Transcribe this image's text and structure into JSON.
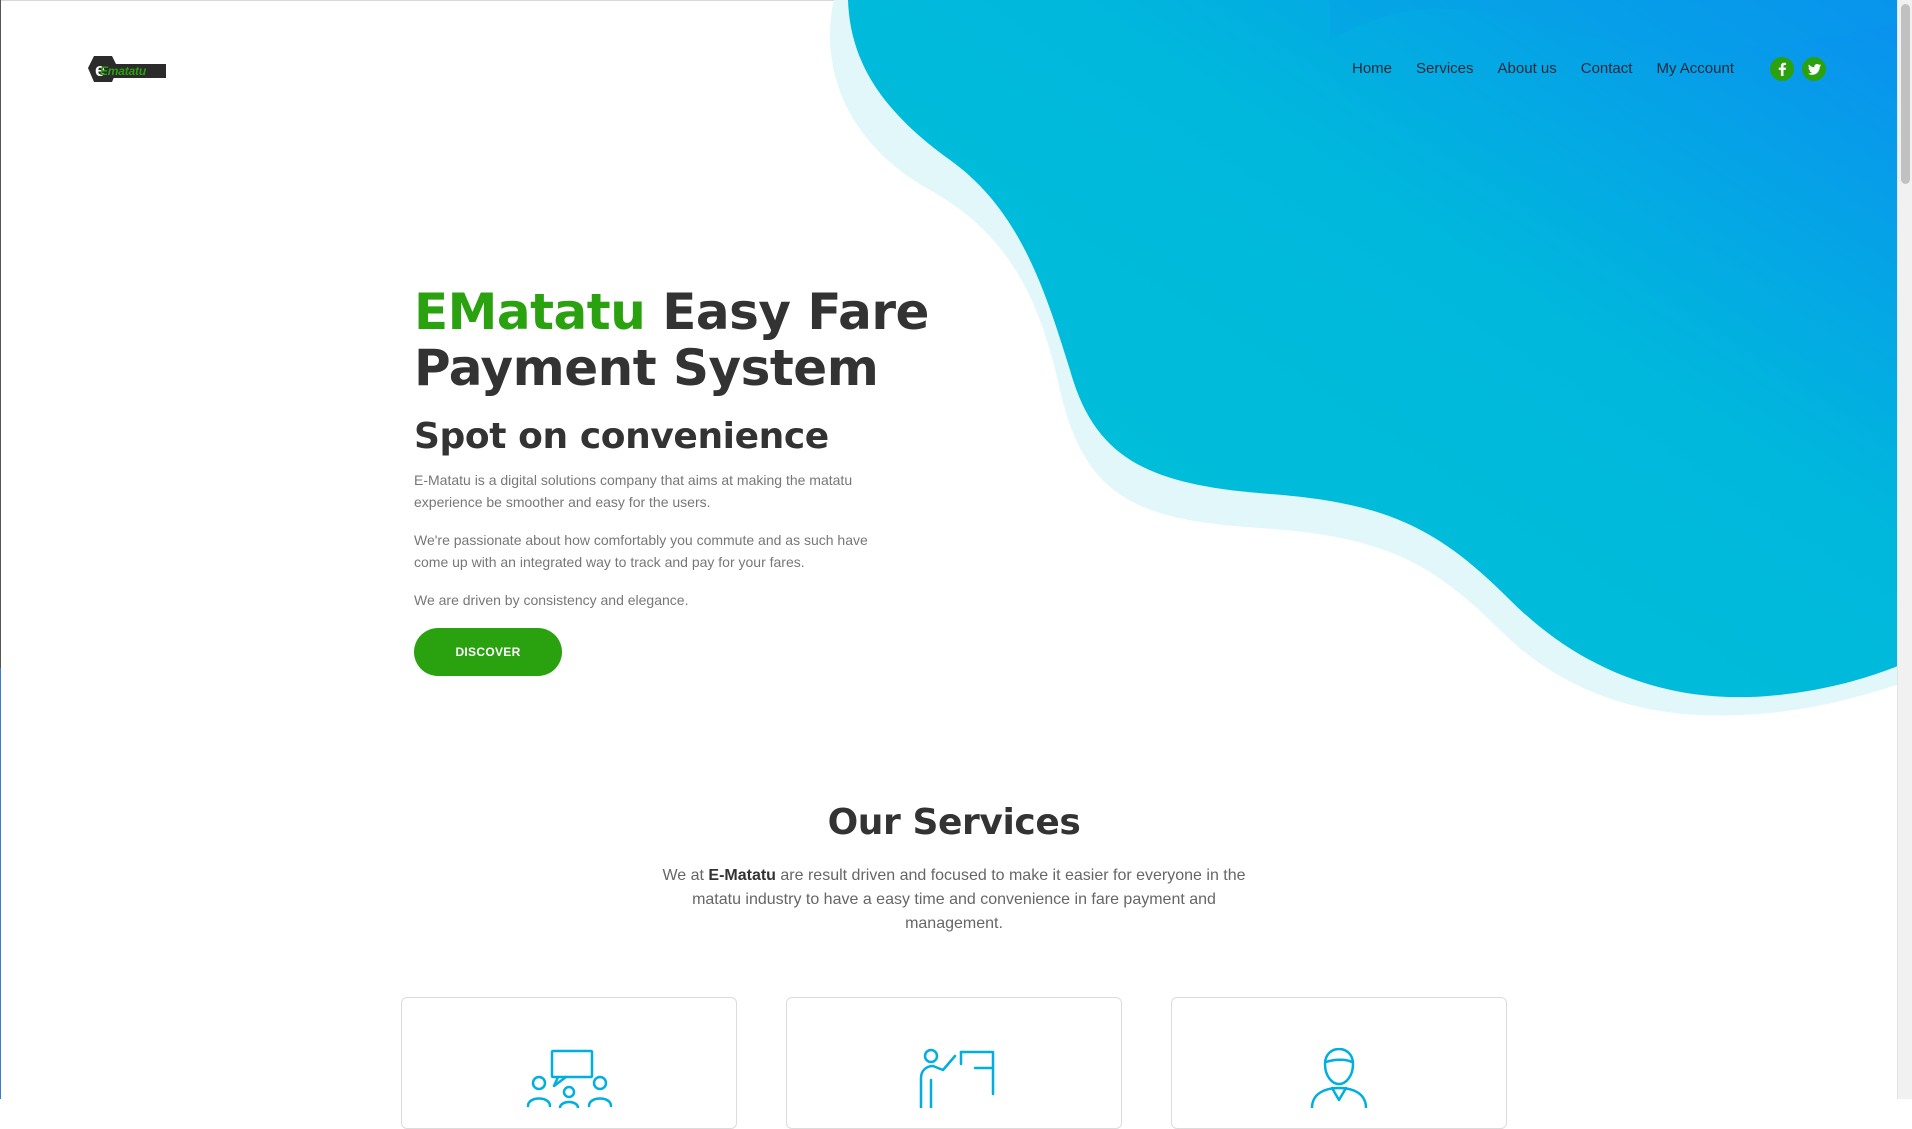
{
  "brand": {
    "logo_text": "Ematatu",
    "accent_color": "#2aa10f",
    "wave_color": "#00bcd4"
  },
  "nav": {
    "items": [
      {
        "label": "Home"
      },
      {
        "label": "Services"
      },
      {
        "label": "About us"
      },
      {
        "label": "Contact"
      },
      {
        "label": "My Account"
      }
    ],
    "socials": [
      {
        "icon": "facebook-icon",
        "glyph": "f"
      },
      {
        "icon": "twitter-icon",
        "glyph": "t"
      }
    ]
  },
  "hero": {
    "title_accent": "EMatatu",
    "title_rest": " Easy Fare Payment System",
    "subtitle": "Spot on convenience",
    "paragraphs": [
      "E-Matatu is a digital solutions company that aims at making the matatu experience be smoother and easy for the users.",
      "We're passionate about how comfortably you commute and as such have come up with an integrated way to track and pay for your fares.",
      "We are driven by consistency and elegance."
    ],
    "cta_label": "DISCOVER"
  },
  "services": {
    "title": "Our Services",
    "desc_prefix": "We at ",
    "desc_brand": "E-Matatu",
    "desc_suffix": " are result driven and focused to make it easier for everyone in the matatu industry to have a easy time and convenience in fare payment and management.",
    "cards": [
      {
        "icon": "meeting-icon"
      },
      {
        "icon": "presentation-icon"
      },
      {
        "icon": "user-icon"
      }
    ]
  }
}
